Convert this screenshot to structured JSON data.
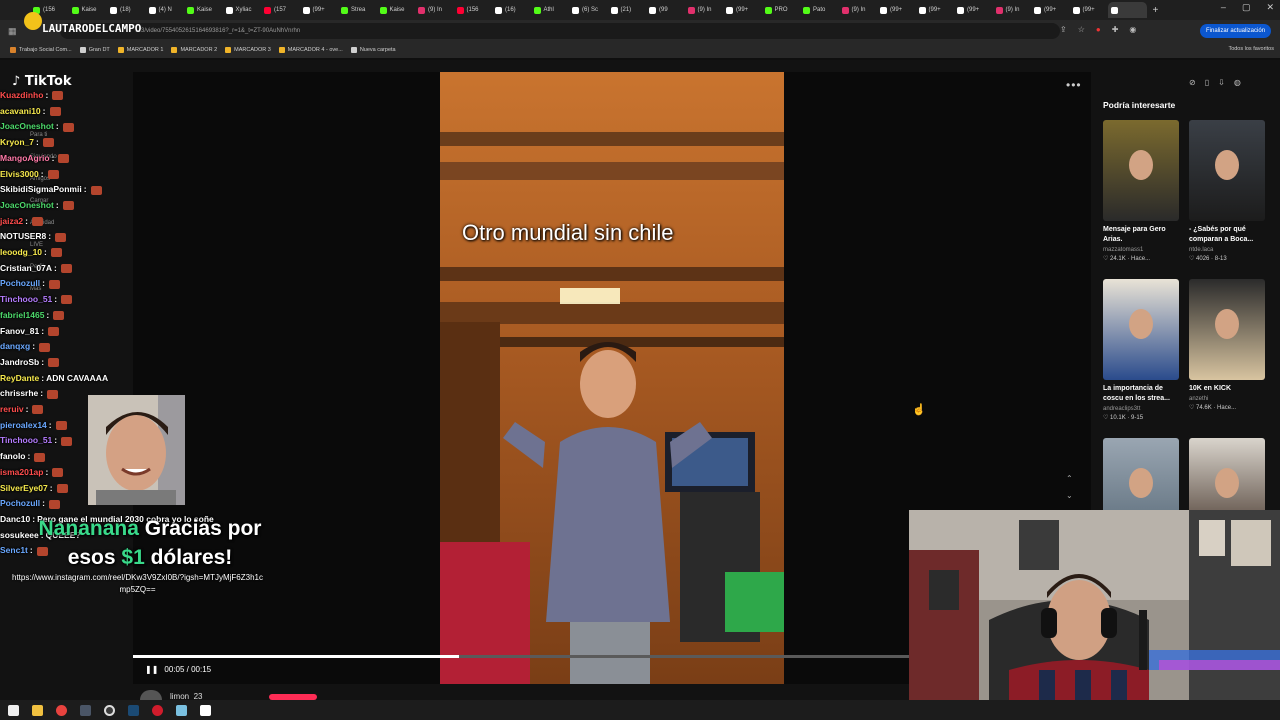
{
  "browser": {
    "tabs": [
      {
        "label": "(156",
        "icon": "kick-icon",
        "color": "#53fc18"
      },
      {
        "label": "Kaise",
        "icon": "kick-icon",
        "color": "#53fc18"
      },
      {
        "label": "(18)",
        "icon": "x-icon",
        "color": "#ffffff"
      },
      {
        "label": "(4) N",
        "icon": "x-icon",
        "color": "#ffffff"
      },
      {
        "label": "Kaise",
        "icon": "kick-icon",
        "color": "#53fc18"
      },
      {
        "label": "Xyliac",
        "icon": "vk-icon",
        "color": "#ffffff"
      },
      {
        "label": "(157",
        "icon": "youtube-icon",
        "color": "#ff0033"
      },
      {
        "label": "(99+",
        "icon": "tiktok-icon",
        "color": "#ffffff"
      },
      {
        "label": "Strea",
        "icon": "kick-icon",
        "color": "#53fc18"
      },
      {
        "label": "Kaise",
        "icon": "kick-icon",
        "color": "#53fc18"
      },
      {
        "label": "(9) In",
        "icon": "instagram-icon",
        "color": "#e1306c"
      },
      {
        "label": "(156",
        "icon": "youtube-icon",
        "color": "#ff0033"
      },
      {
        "label": "(16)",
        "icon": "x-icon",
        "color": "#ffffff"
      },
      {
        "label": "Athl",
        "icon": "kick-icon",
        "color": "#53fc18"
      },
      {
        "label": "(6) Sc",
        "icon": "x-icon",
        "color": "#ffffff"
      },
      {
        "label": "(21)",
        "icon": "x-icon",
        "color": "#ffffff"
      },
      {
        "label": "(99",
        "icon": "tiktok-icon",
        "color": "#ffffff"
      },
      {
        "label": "(9) In",
        "icon": "instagram-icon",
        "color": "#e1306c"
      },
      {
        "label": "(99+",
        "icon": "tiktok-icon",
        "color": "#ffffff"
      },
      {
        "label": "PRO",
        "icon": "kick-icon",
        "color": "#53fc18"
      },
      {
        "label": "Pato",
        "icon": "kick-icon",
        "color": "#53fc18"
      },
      {
        "label": "(9) In",
        "icon": "instagram-icon",
        "color": "#e1306c"
      },
      {
        "label": "(99+",
        "icon": "tiktok-icon",
        "color": "#ffffff"
      },
      {
        "label": "(99+",
        "icon": "tiktok-icon",
        "color": "#ffffff"
      },
      {
        "label": "(99+",
        "icon": "tiktok-icon",
        "color": "#ffffff"
      },
      {
        "label": "(9) In",
        "icon": "instagram-icon",
        "color": "#e1306c"
      },
      {
        "label": "(99+",
        "icon": "tiktok-icon",
        "color": "#ffffff"
      },
      {
        "label": "(99+",
        "icon": "tiktok-icon",
        "color": "#ffffff"
      },
      {
        "label": "",
        "icon": "tiktok-icon",
        "color": "#ffffff",
        "active": true
      }
    ],
    "address": "…3/video/7554052615164693816?_r=1&_t=ZT-90AuNhVnrhn",
    "update_button": "Finalizar actualización",
    "bookmarks": [
      {
        "label": "Trabajo Social Com...",
        "color": "#d9822b"
      },
      {
        "label": "Gran DT",
        "color": "#cfcfcf"
      },
      {
        "label": "MARCADOR 1",
        "color": "#f0b429"
      },
      {
        "label": "MARCADOR 2",
        "color": "#f0b429"
      },
      {
        "label": "MARCADOR 3",
        "color": "#f0b429"
      },
      {
        "label": "MARCADOR 4 - ove...",
        "color": "#f0b429"
      },
      {
        "label": "Nueva carpeta",
        "color": "#cfcfcf"
      }
    ],
    "all_bookmarks": "Todos los favoritos"
  },
  "tiktok": {
    "logo": "TikTok",
    "nav": [
      "Para ti",
      "Siguiendo",
      "Amigos",
      "Cargar",
      "Actividad",
      "LIVE",
      "Perfil",
      "Más"
    ],
    "video_caption": "Otro mundial sin chile",
    "time": "00:05 / 00:15",
    "progress_fraction": 0.42,
    "author_handle": "limon_23",
    "accent": "#fe2c55",
    "recommend_title": "Podría interesarte",
    "cards": [
      {
        "title": "Mensaje para Gero Arias.",
        "user": "mazzatomass1",
        "stats": "24.1K · Hace..."
      },
      {
        "title": "- ¿Sabés por qué comparan a Boca...",
        "user": "ntde.laca",
        "stats": "4026 · 8-13"
      },
      {
        "title": "La importancia de coscu en los strea...",
        "user": "andreaclips3tt",
        "stats": "10.1K · 9-15"
      },
      {
        "title": "10K en KICK",
        "user": "anzethi",
        "stats": "74.6K · Hace..."
      },
      {
        "title": "",
        "user": "",
        "stats": ""
      },
      {
        "title": "",
        "user": "",
        "stats": ""
      }
    ]
  },
  "stream": {
    "channel_name": "LAUTARODELCAMPO",
    "chat": [
      {
        "user": "Kuazdinho",
        "color": "#ff4d4d",
        "msg": ""
      },
      {
        "user": "acavani10",
        "color": "#f6e94d",
        "msg": ""
      },
      {
        "user": "JoacOneshot",
        "color": "#4dd96b",
        "msg": ""
      },
      {
        "user": "Kryon_7",
        "color": "#f6e94d",
        "msg": ""
      },
      {
        "user": "MangoAgrio",
        "color": "#ff7aa8",
        "msg": ""
      },
      {
        "user": "Elvis3000",
        "color": "#f6e94d",
        "msg": ""
      },
      {
        "user": "SkibidiSigmaPonmii",
        "color": "#ffffff",
        "msg": ""
      },
      {
        "user": "JoacOneshot",
        "color": "#4dd96b",
        "msg": ""
      },
      {
        "user": "jaiza2",
        "color": "#ff4d4d",
        "msg": ""
      },
      {
        "user": "NOTUSER8",
        "color": "#ffffff",
        "msg": ""
      },
      {
        "user": "leoodg_10",
        "color": "#f6e94d",
        "msg": ""
      },
      {
        "user": "Cristian_07A",
        "color": "#ffffff",
        "msg": ""
      },
      {
        "user": "Pochozull",
        "color": "#6aa8ff",
        "msg": ""
      },
      {
        "user": "Tinchooo_51",
        "color": "#b57cff",
        "msg": ""
      },
      {
        "user": "fabriel1465",
        "color": "#4dd96b",
        "msg": ""
      },
      {
        "user": "Fanov_81",
        "color": "#ffffff",
        "msg": ""
      },
      {
        "user": "danqxg",
        "color": "#6aa8ff",
        "msg": ""
      },
      {
        "user": "JandroSb",
        "color": "#ffffff",
        "msg": ""
      },
      {
        "user": "ReyDante",
        "color": "#f6e94d",
        "msg": "ADN  CAVAAAA"
      },
      {
        "user": "chrissrhe",
        "color": "#ffffff",
        "msg": ""
      },
      {
        "user": "reruiv",
        "color": "#ff4d4d",
        "msg": ""
      },
      {
        "user": "pieroalex14",
        "color": "#6aa8ff",
        "msg": ""
      },
      {
        "user": "Tinchooo_51",
        "color": "#b57cff",
        "msg": ""
      },
      {
        "user": "fanolo",
        "color": "#ffffff",
        "msg": ""
      },
      {
        "user": "isma201ap",
        "color": "#ff4d4d",
        "msg": ""
      },
      {
        "user": "SilverEye07",
        "color": "#f6e94d",
        "msg": ""
      },
      {
        "user": "Pochozull",
        "color": "#6aa8ff",
        "msg": ""
      },
      {
        "user": "Danc10",
        "color": "#ffffff",
        "msg": "Pero gane el mundial 2030 cobra yo lo soñe"
      },
      {
        "user": "sosukeee",
        "color": "#ffffff",
        "msg": "QUEEE?"
      },
      {
        "user": "Senc1t",
        "color": "#6aa8ff",
        "msg": ""
      }
    ],
    "donation_name": "Nananana",
    "donation_text": "Gracias por",
    "donation_prefix": "esos",
    "donation_amount": "$1",
    "donation_suffix": "dólares!",
    "donation_link": "https://www.instagram.com/reel/DKw3V9ZxI0B/?igsh=MTJyMjF6Z3h1cmp5ZQ=="
  }
}
